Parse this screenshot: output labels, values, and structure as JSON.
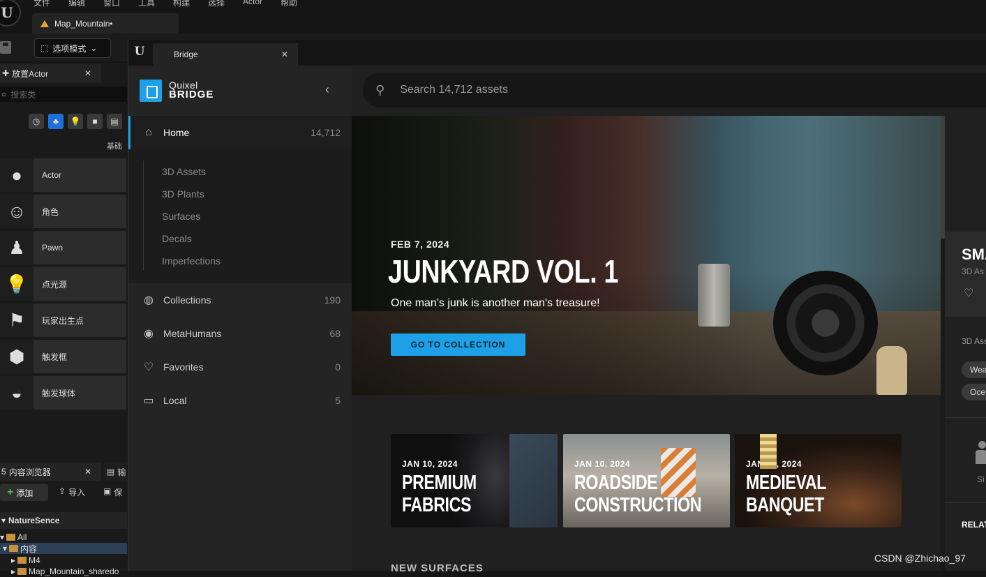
{
  "menu": [
    "文件",
    "编辑",
    "窗口",
    "工具",
    "构建",
    "选择",
    "Actor",
    "帮助"
  ],
  "editor": {
    "doc_tab": "Map_Mountain•",
    "mode_button": "选项模式",
    "place_panel_title": "放置Actor",
    "search_placeholder": "搜索类",
    "filter_icons": [
      "clock-icon",
      "shapes-icon",
      "light-icon",
      "cube-icon",
      "clapper-icon"
    ],
    "basic_label": "基础",
    "actors": [
      {
        "label": "Actor",
        "icon": "sphere-icon"
      },
      {
        "label": "角色",
        "icon": "character-icon"
      },
      {
        "label": "Pawn",
        "icon": "pawn-icon"
      },
      {
        "label": "点光源",
        "icon": "point-light-icon"
      },
      {
        "label": "玩家出生点",
        "icon": "player-start-icon"
      },
      {
        "label": "触发框",
        "icon": "trigger-box-icon"
      },
      {
        "label": "触发球体",
        "icon": "trigger-sphere-icon"
      }
    ],
    "content_browser_tab": "内容浏览器",
    "content_browser_tab_prefix": "5",
    "second_tab_partial": "输",
    "add_button": "添加",
    "import_button": "导入",
    "save_button_partial": "保",
    "folder_root": "NatureSence",
    "tree": [
      {
        "label": "All",
        "indent": 0
      },
      {
        "label": "内容",
        "indent": 1,
        "selected": true
      },
      {
        "label": "M4",
        "indent": 2
      },
      {
        "label": "Map_Mountain_sharedo",
        "indent": 2
      }
    ]
  },
  "bridge": {
    "tab_title": "Bridge",
    "brand_top": "Quixel",
    "brand_bottom": "BRIDGE",
    "brand_color": "#1ea0e6",
    "nav": {
      "home": {
        "label": "Home",
        "count": "14,712"
      },
      "sub_items": [
        "3D Assets",
        "3D Plants",
        "Surfaces",
        "Decals",
        "Imperfections"
      ],
      "collections": {
        "label": "Collections",
        "count": "190"
      },
      "metahumans": {
        "label": "MetaHumans",
        "count": "68"
      },
      "favorites": {
        "label": "Favorites",
        "count": "0"
      },
      "local": {
        "label": "Local",
        "count": "5"
      }
    },
    "search_placeholder": "Search 14,712 assets",
    "hero": {
      "date": "FEB 7, 2024",
      "title": "JUNKYARD VOL. 1",
      "subtitle": "One man's junk is another man's treasure!",
      "button": "GO TO COLLECTION"
    },
    "cards": [
      {
        "date": "JAN 10, 2024",
        "line1": "PREMIUM",
        "line2": "FABRICS"
      },
      {
        "date": "JAN 10, 2024",
        "line1": "ROADSIDE",
        "line2": "CONSTRUCTION"
      },
      {
        "date": "JAN 10, 2024",
        "line1": "MEDIEVAL",
        "line2": "BANQUET"
      }
    ],
    "section_heading": "NEW SURFACES",
    "detail": {
      "title_partial": "SMA",
      "type_partial": "3D As",
      "subheading_partial": "3D Ass",
      "chips": [
        "Wea",
        "Oce"
      ],
      "people_label_partial": "Si",
      "related_partial": "RELAT"
    }
  },
  "watermark": "CSDN @Zhichao_97"
}
